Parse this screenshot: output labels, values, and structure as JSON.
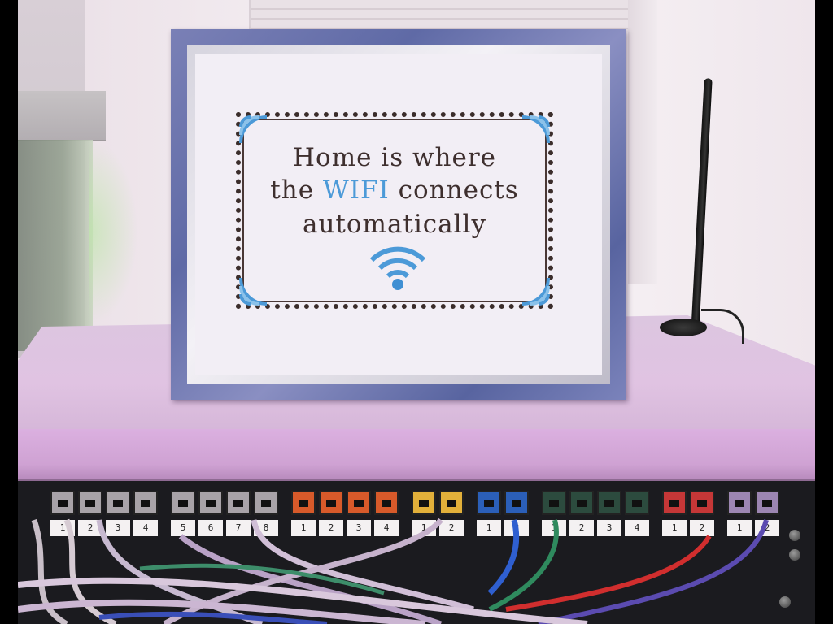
{
  "sign": {
    "line1": "Home is where",
    "line2_prefix": "the ",
    "line2_highlight": "WIFI",
    "line2_suffix": " connects",
    "line3": "automatically"
  },
  "colors": {
    "stitch_text": "#3e2f2e",
    "wifi_blue": "#4c9ad8",
    "frame_blue": "#6b73b0",
    "shelf_lavender": "#dcb6df"
  },
  "icons": [
    "wifi-icon",
    "corner-wifi-icon"
  ],
  "patch_panel": {
    "groups": [
      {
        "color": "gray",
        "labels": [
          "1",
          "2",
          "3",
          "4"
        ]
      },
      {
        "color": "gray",
        "labels": [
          "5",
          "6",
          "7",
          "8"
        ]
      },
      {
        "color": "orange",
        "labels": [
          "1",
          "2",
          "3",
          "4"
        ]
      },
      {
        "color": "yellow",
        "labels": [
          "1",
          "2"
        ]
      },
      {
        "color": "blue",
        "labels": [
          "1",
          "2"
        ]
      },
      {
        "color": "green",
        "labels": [
          "1",
          "2",
          "3",
          "4"
        ]
      },
      {
        "color": "red",
        "labels": [
          "1",
          "2"
        ]
      },
      {
        "color": "purple",
        "labels": [
          "1",
          "2"
        ]
      }
    ]
  }
}
